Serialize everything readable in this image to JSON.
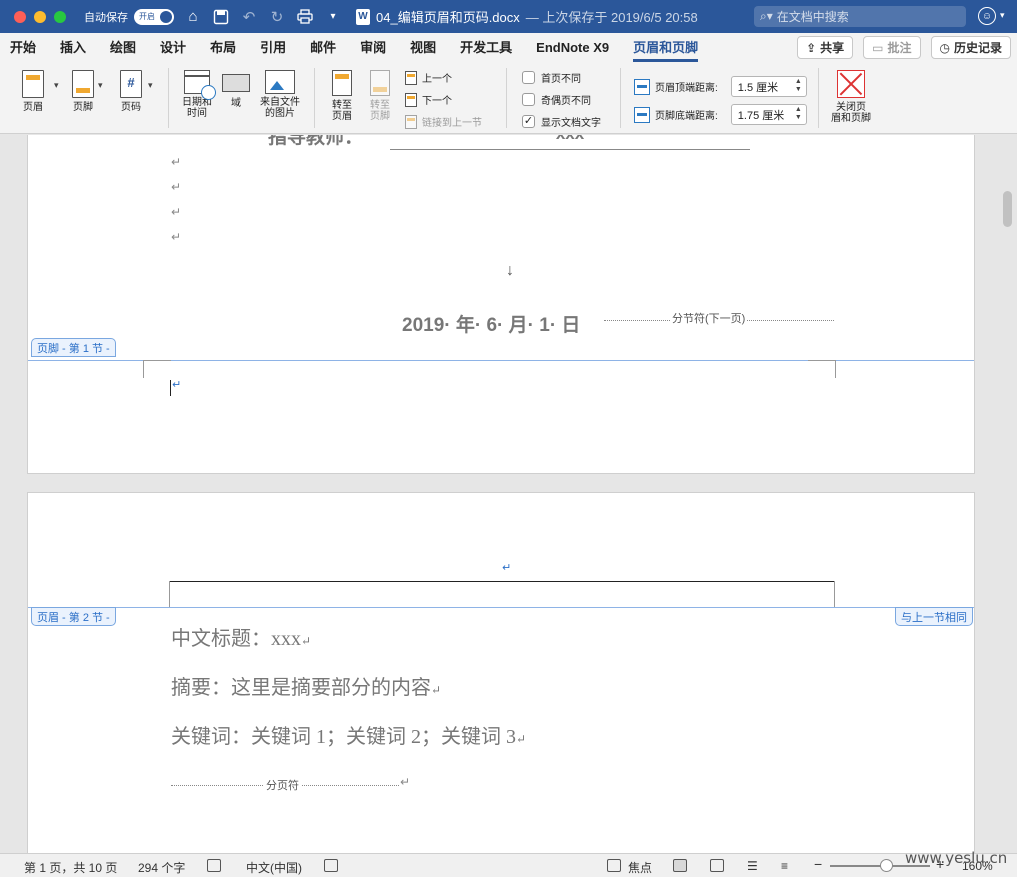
{
  "titlebar": {
    "autosave_label": "自动保存",
    "autosave_toggle": "开启",
    "doc_name": "04_编辑页眉和页码.docx",
    "saved_status": "— 上次保存于 2019/6/5 20:58",
    "search_placeholder": "在文档中搜索",
    "icons": [
      "home-icon",
      "save-icon",
      "undo-icon",
      "redo-icon",
      "print-icon",
      "customize-toolbar-icon",
      "feedback-smiley-icon"
    ]
  },
  "tabs": [
    "开始",
    "插入",
    "绘图",
    "设计",
    "布局",
    "引用",
    "邮件",
    "审阅",
    "视图",
    "开发工具",
    "EndNote X9",
    "页眉和页脚"
  ],
  "active_tab": "页眉和页脚",
  "tab_actions": {
    "share": "共享",
    "comments": "批注",
    "history": "历史记录"
  },
  "ribbon": {
    "header": "页眉",
    "footer": "页脚",
    "page_number": "页码",
    "date_time_l1": "日期和",
    "date_time_l2": "时间",
    "field": "域",
    "picture_l1": "来自文件",
    "picture_l2": "的图片",
    "goto_header_l1": "转至",
    "goto_header_l2": "页眉",
    "goto_footer_l1": "转至",
    "goto_footer_l2": "页脚",
    "previous": "上一个",
    "next": "下一个",
    "link_previous": "链接到上一节",
    "different_first": "首页不同",
    "different_odd_even": "奇偶页不同",
    "show_doc_text": "显示文档文字",
    "show_doc_text_checked": "✓",
    "header_top_label": "页眉顶端距离:",
    "header_top_value": "1.5 厘米",
    "footer_bottom_label": "页脚底端距离:",
    "footer_bottom_value": "1.75 厘米",
    "close_l1": "关闭页",
    "close_l2": "眉和页脚"
  },
  "document": {
    "advisor_label": "指导教师：",
    "advisor_value": "xxx",
    "date_line": "2019· 年· 6· 月· 1· 日",
    "section_break": "分节符(下一页)",
    "footer_tag": "页脚 - 第 1 节 -",
    "header_tag": "页眉 - 第 2 节 -",
    "same_as_previous": "与上一节相同",
    "cn_title": "中文标题：xxx",
    "abstract": "摘要：这里是摘要部分的内容",
    "keywords": "关键词：关键词 1；关键词 2；关键词 3",
    "page_break": "分页符",
    "para_mark": "↵",
    "down_arrow": "↓"
  },
  "statusbar": {
    "page_info": "第 1 页，共 10 页",
    "word_count": "294 个字",
    "language": "中文(中国)",
    "focus": "焦点",
    "zoom_minus": "−",
    "zoom_plus": "+",
    "zoom": "160%"
  },
  "watermark": "www.yeslu.cn"
}
